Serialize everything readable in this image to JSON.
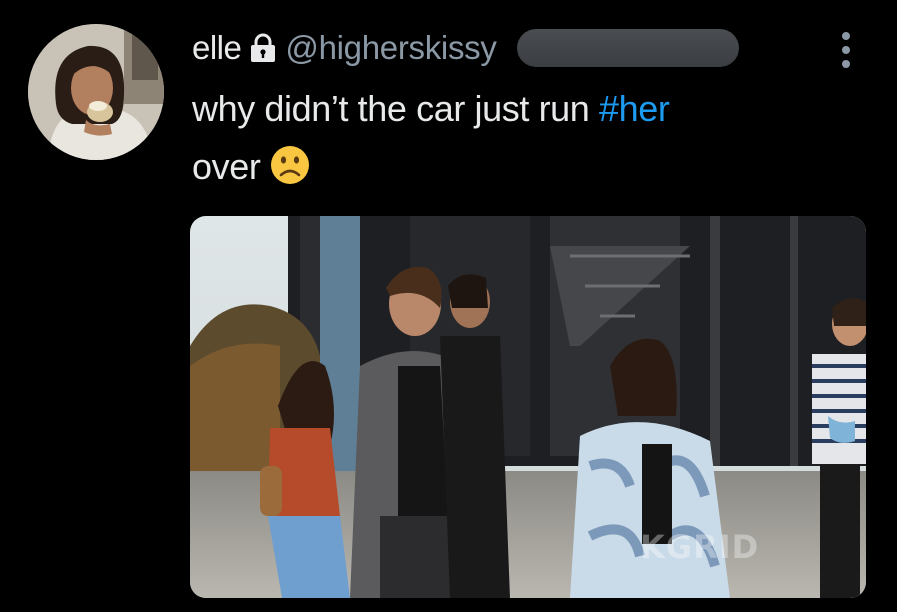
{
  "tweet": {
    "author_name": "elle",
    "handle": "@higherskissy",
    "text_before": "why didn’t the car just run ",
    "hashtag": "#her",
    "text_after": "over",
    "emoji_icon": "frowning-face-icon"
  },
  "media": {
    "watermark": "KGRID"
  },
  "colors": {
    "background": "#000000",
    "text": "#e7e9ea",
    "secondary": "#8b98a5",
    "link": "#1d9bf0",
    "redaction": "#44474c"
  }
}
